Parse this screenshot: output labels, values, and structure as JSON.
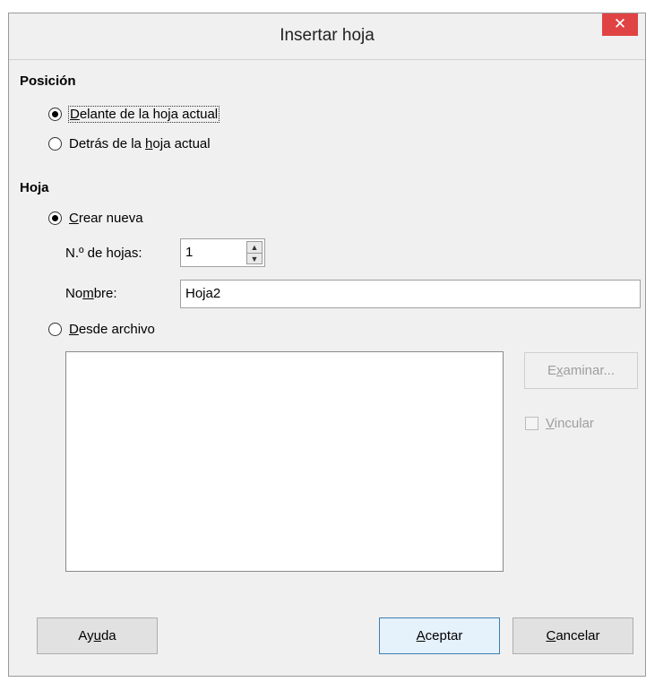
{
  "window": {
    "title": "Insertar hoja",
    "close_glyph": "✕"
  },
  "position": {
    "heading": "Posición",
    "options": [
      {
        "pre": "",
        "accel": "D",
        "post": "elante de la hoja actual",
        "checked": true
      },
      {
        "pre": "Detrás de la ",
        "accel": "h",
        "post": "oja actual",
        "checked": false
      }
    ]
  },
  "sheet": {
    "heading": "Hoja",
    "create_new": {
      "pre": "",
      "accel": "C",
      "post": "rear nueva",
      "checked": true
    },
    "count": {
      "label_pre": "N.º de ho",
      "label_accel": "j",
      "label_post": "as:",
      "value": "1"
    },
    "name": {
      "label_pre": "No",
      "label_accel": "m",
      "label_post": "bre:",
      "value": "Hoja2"
    },
    "from_file": {
      "pre": "",
      "accel": "D",
      "post": "esde archivo",
      "checked": false
    },
    "browse": {
      "pre": "E",
      "accel": "x",
      "post": "aminar..."
    },
    "link": {
      "pre": "",
      "accel": "V",
      "post": "incular"
    }
  },
  "buttons": {
    "help": {
      "pre": "Ay",
      "accel": "u",
      "post": "da"
    },
    "ok": {
      "pre": "",
      "accel": "A",
      "post": "ceptar"
    },
    "cancel": {
      "pre": "",
      "accel": "C",
      "post": "ancelar"
    }
  },
  "icons": {
    "spin_up": "▲",
    "spin_down": "▼"
  }
}
